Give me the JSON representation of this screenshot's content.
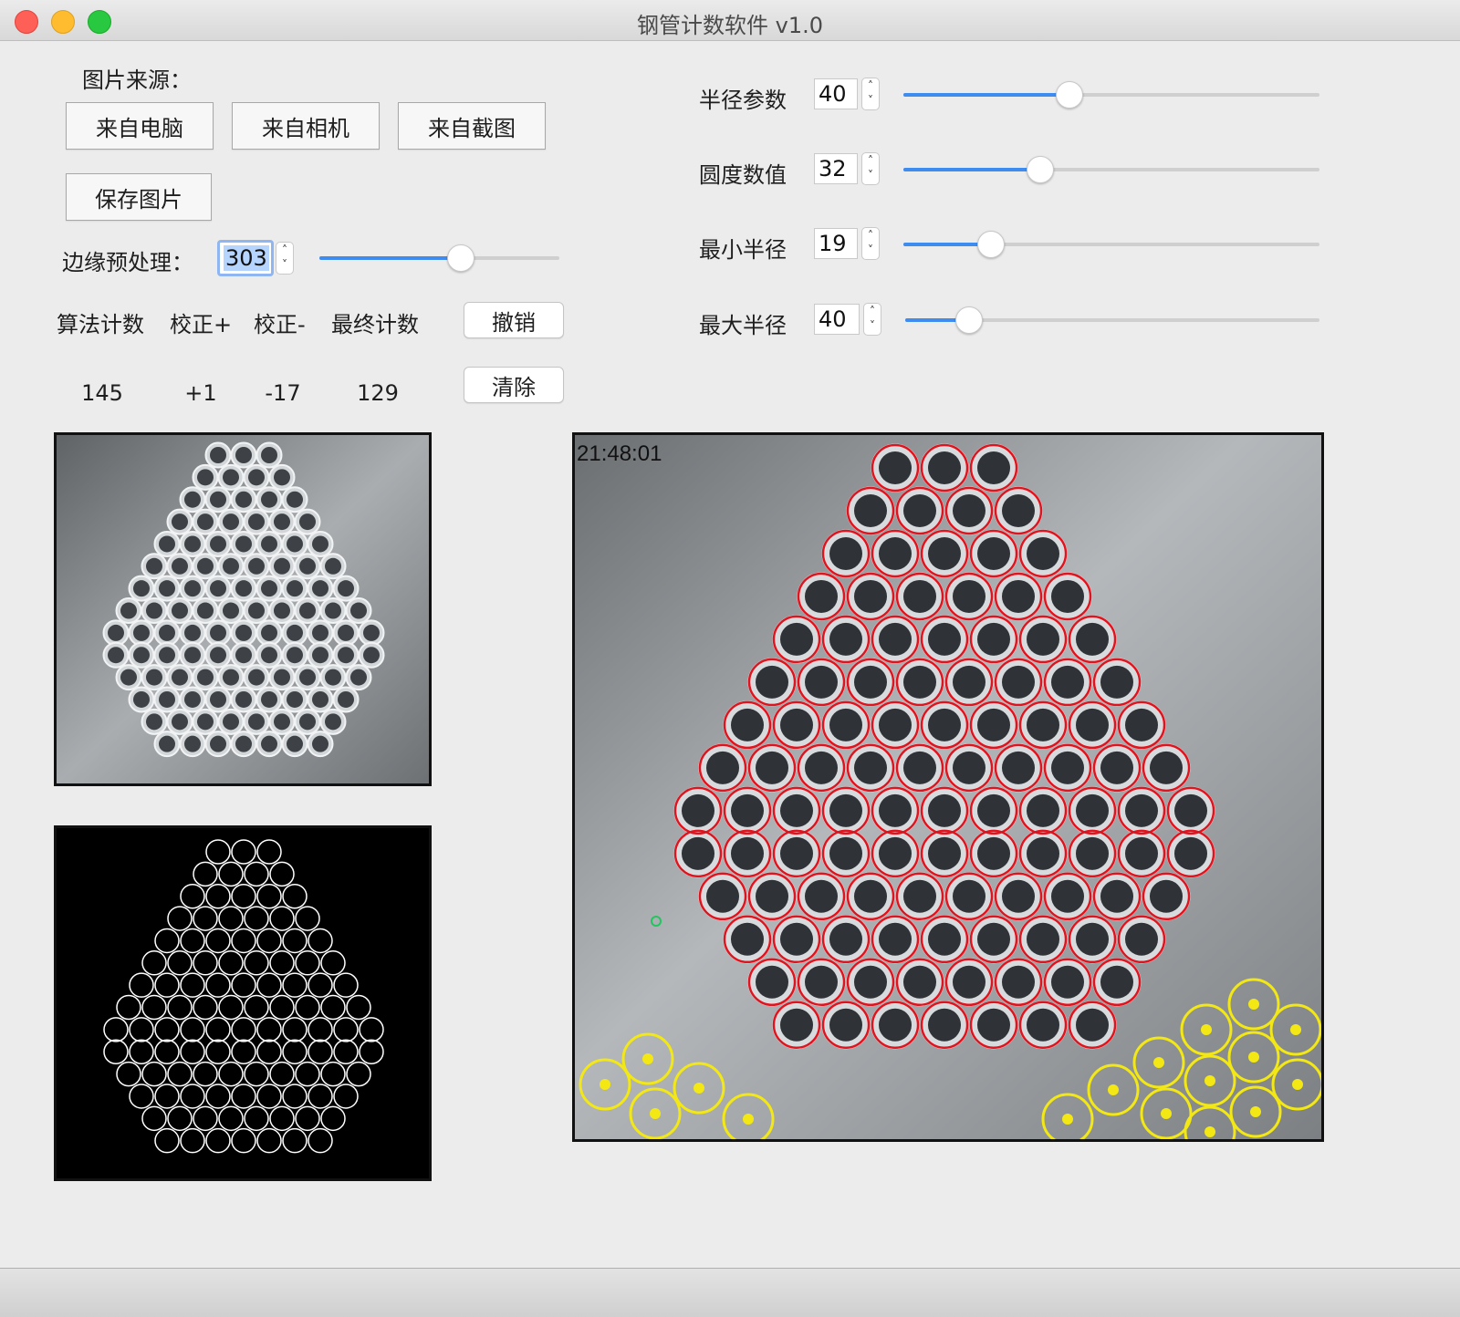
{
  "window": {
    "title": "钢管计数软件 v1.0"
  },
  "source": {
    "label": "图片来源：",
    "btn_computer": "来自电脑",
    "btn_camera": "来自相机",
    "btn_screenshot": "来自截图",
    "btn_save": "保存图片"
  },
  "edge": {
    "label": "边缘预处理：",
    "value": "303",
    "slider_fraction": 0.59
  },
  "params": [
    {
      "label": "半径参数",
      "value": "40",
      "slider_fraction": 0.4
    },
    {
      "label": "圆度数值",
      "value": "32",
      "slider_fraction": 0.33
    },
    {
      "label": "最小半径",
      "value": "19",
      "slider_fraction": 0.21
    },
    {
      "label": "最大半径",
      "value": "40",
      "slider_fraction": 0.155
    }
  ],
  "counts": {
    "headers": [
      "算法计数",
      "校正+",
      "校正-",
      "最终计数"
    ],
    "values": [
      "145",
      "+1",
      "-17",
      "129"
    ]
  },
  "actions": {
    "undo": "撤销",
    "clear": "清除"
  },
  "result": {
    "timestamp": "21:48:01"
  },
  "colors": {
    "detected": "#e0141e",
    "removed": "#f3e814",
    "added": "#22c55e",
    "accent": "#3f8cf1"
  }
}
